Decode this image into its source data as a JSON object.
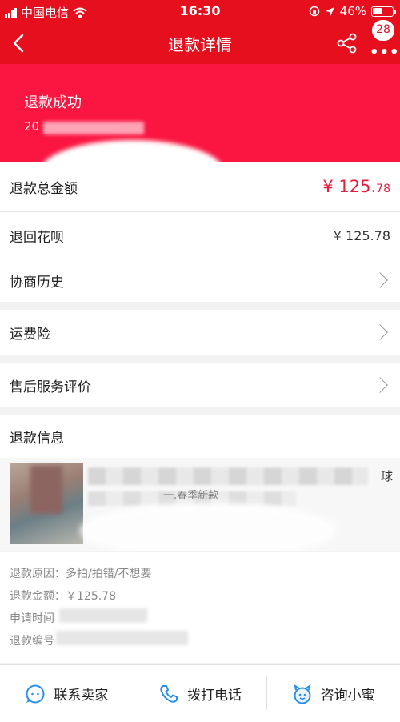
{
  "statusbar": {
    "carrier": "中国电信",
    "time": "16:30",
    "battery": "46%"
  },
  "navbar": {
    "title": "退款详情",
    "badge": "28"
  },
  "hero": {
    "status": "退款成功",
    "number_prefix": "20"
  },
  "rows": {
    "total_label": "退款总金额",
    "total_currency": "¥",
    "total_int": "125.",
    "total_dec": "78",
    "huabei_label": "退回花呗",
    "huabei_value": "¥ 125.78",
    "history_label": "协商历史",
    "insurance_label": "运费险",
    "review_label": "售后服务评价",
    "refund_info_label": "退款信息"
  },
  "product": {
    "title_tail": "球",
    "sku_hint": "一.春季新款"
  },
  "info": {
    "reason": "退款原因：多拍/拍错/不想要",
    "amount": "退款金额：￥125.78",
    "time_label": "申请时间",
    "number_label": "退款编号"
  },
  "bottom": {
    "contact_seller": "联系卖家",
    "call": "拨打电话",
    "assistant": "咨询小蜜"
  },
  "colors": {
    "brand_red": "#e60f1d",
    "hero_pink": "#fb1641",
    "price_red": "#e51d3d"
  },
  "icons": [
    "back-icon",
    "share-icon",
    "more-icon",
    "chevron-right-icon",
    "chat-icon",
    "phone-icon",
    "assistant-icon"
  ]
}
